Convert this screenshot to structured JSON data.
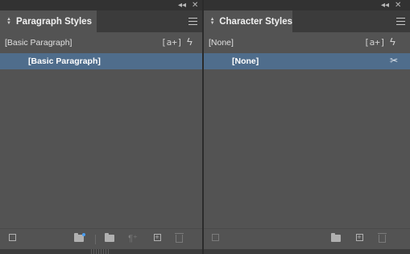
{
  "window_controls": {
    "collapse": "◂◂",
    "close": "✕"
  },
  "paragraph_panel": {
    "tab_title": "Paragraph Styles",
    "current_style": "[Basic Paragraph]",
    "new_style_glyph": "[a+]",
    "quick_apply_glyph": "ϟ",
    "items": [
      {
        "label": "[Basic Paragraph]",
        "selected": true
      }
    ],
    "footer_glyphs": {
      "override": "¶⁺"
    }
  },
  "character_panel": {
    "tab_title": "Character Styles",
    "current_style": "[None]",
    "new_style_glyph": "[a+]",
    "quick_apply_glyph": "ϟ",
    "items": [
      {
        "label": "[None]",
        "selected": true
      }
    ],
    "row_icon_glyph": "✂"
  },
  "colors": {
    "panel_bg": "#535353",
    "tab_bar_bg": "#3b3b3b",
    "selection": "#4f6d8c",
    "accent_dot": "#4a9df0"
  }
}
